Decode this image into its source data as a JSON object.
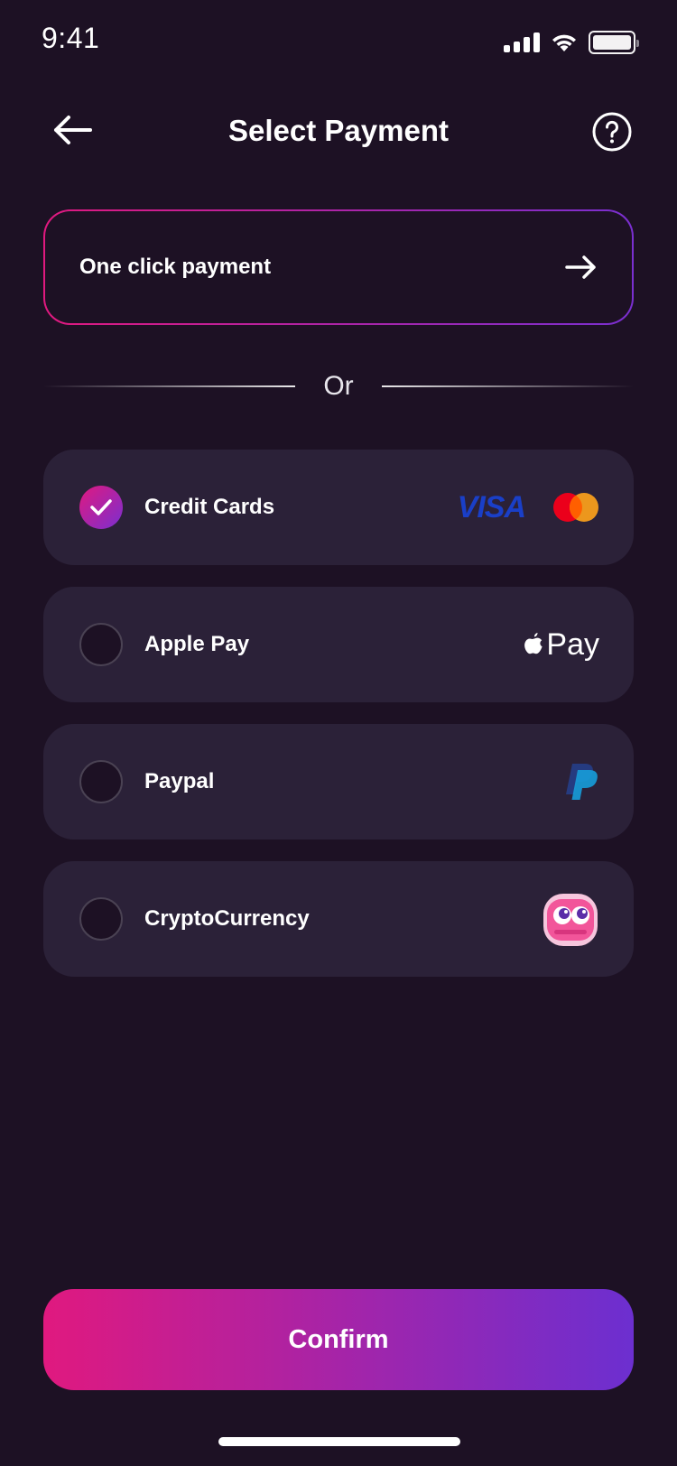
{
  "status_bar": {
    "time": "9:41"
  },
  "header": {
    "title": "Select Payment"
  },
  "one_click": {
    "label": "One click payment"
  },
  "divider": {
    "label": "Or"
  },
  "options": [
    {
      "label": "Credit Cards",
      "selected": true,
      "logos": [
        "VISA",
        "mastercard-icon"
      ]
    },
    {
      "label": "Apple Pay",
      "selected": false,
      "logos": [
        "apple-icon",
        "Pay"
      ]
    },
    {
      "label": "Paypal",
      "selected": false,
      "logos": [
        "paypal-icon"
      ]
    },
    {
      "label": "CryptoCurrency",
      "selected": false,
      "logos": [
        "crypto-mascot-icon"
      ]
    }
  ],
  "confirm": {
    "label": "Confirm"
  },
  "colors": {
    "background": "#1D1124",
    "card": "#2B2138",
    "accent_start": "#E0197F",
    "accent_end": "#7A2FD0",
    "visa": "#1A3FC7"
  }
}
